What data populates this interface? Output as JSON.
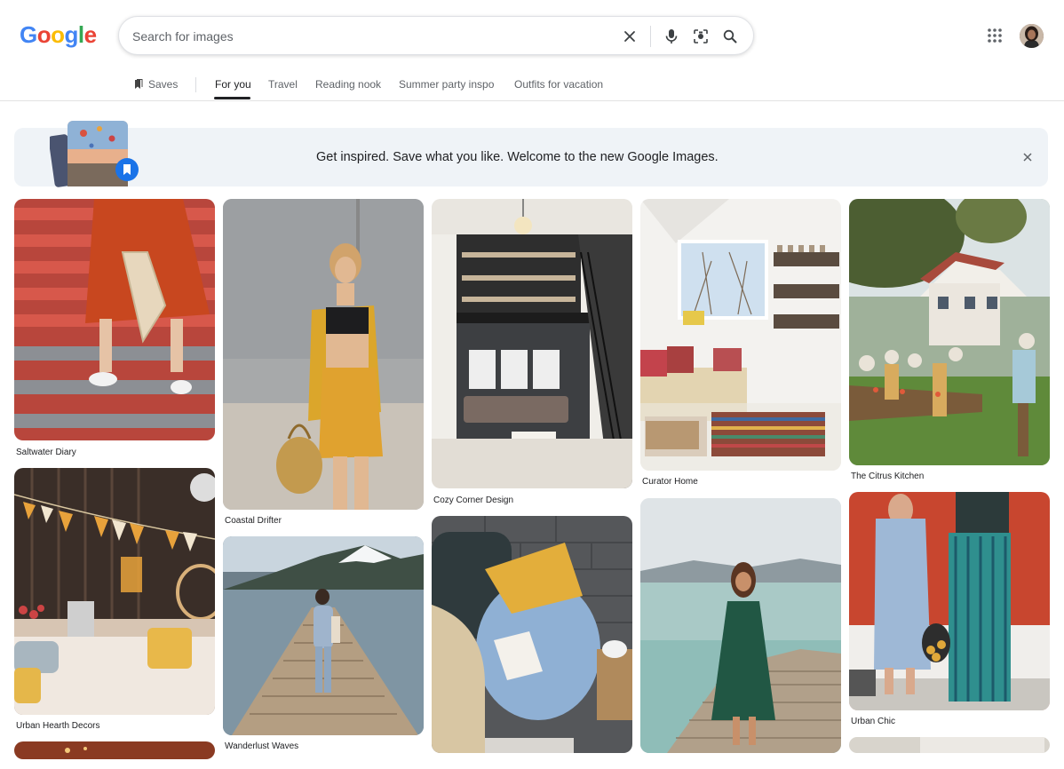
{
  "header": {
    "logo_letters": [
      "G",
      "o",
      "o",
      "g",
      "l",
      "e"
    ],
    "logo_colors": [
      "#4285F4",
      "#EA4335",
      "#FBBC05",
      "#4285F4",
      "#34A853",
      "#EA4335"
    ],
    "search_placeholder": "Search for images",
    "icons": [
      "close-icon",
      "microphone-icon",
      "lens-icon",
      "search-icon",
      "apps-grid-icon",
      "avatar"
    ]
  },
  "tabs": {
    "saves": "Saves",
    "items": [
      "For you",
      "Travel",
      "Reading nook",
      "Summer party inspo",
      "Outfits for vacation"
    ],
    "active": "For you"
  },
  "banner": {
    "text": "Get inspired. Save what you like. Welcome to the new Google Images."
  },
  "cards": [
    {
      "caption": "Saltwater Diary"
    },
    {
      "caption": "Urban Hearth Decors"
    },
    {
      "caption": "Coastal Drifter"
    },
    {
      "caption": "Wanderlust Waves"
    },
    {
      "caption": "Cozy Corner Design"
    },
    {
      "caption": "Curator Home"
    },
    {
      "caption": "The Citrus Kitchen"
    },
    {
      "caption": "Urban Chic"
    }
  ],
  "colors": {
    "accent_blue": "#1a73e8",
    "banner_bg": "#eff3f7",
    "tab_underline": "#202124"
  }
}
